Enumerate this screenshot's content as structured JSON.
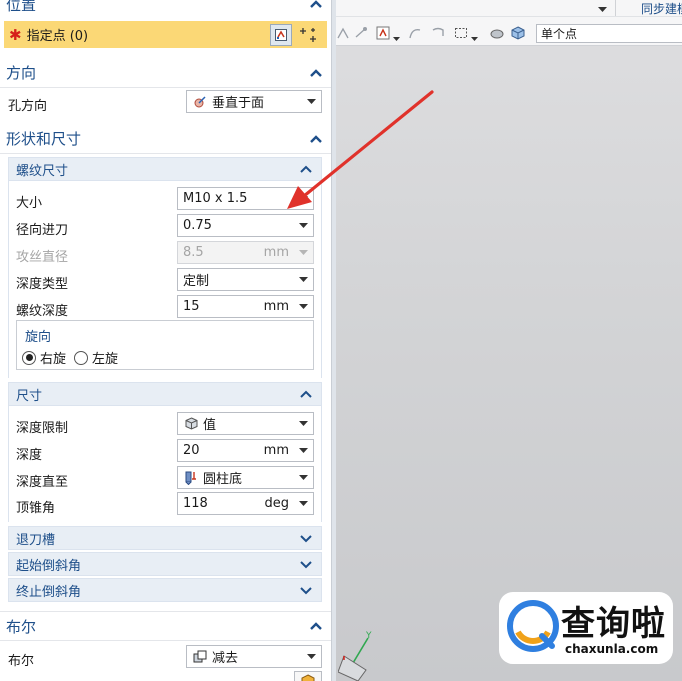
{
  "toolbar": {
    "sync_label": "同步建模",
    "filter_value": "单个点"
  },
  "sections": {
    "position": {
      "title": "位置",
      "specify_point": "指定点 (0)"
    },
    "direction": {
      "title": "方向",
      "hole_direction_label": "孔方向",
      "hole_direction_value": "垂直于面"
    },
    "shape_size": {
      "title": "形状和尺寸",
      "thread_size": {
        "title": "螺纹尺寸",
        "size_label": "大小",
        "size_value": "M10 x 1.5",
        "radial_feed_label": "径向进刀",
        "radial_feed_value": "0.75",
        "tap_diameter_label": "攻丝直径",
        "tap_diameter_value": "8.5",
        "tap_diameter_unit": "mm",
        "depth_type_label": "深度类型",
        "depth_type_value": "定制",
        "thread_depth_label": "螺纹深度",
        "thread_depth_value": "15",
        "thread_depth_unit": "mm",
        "rotation": {
          "title": "旋向",
          "right_label": "右旋",
          "left_label": "左旋"
        }
      },
      "dimensions": {
        "title": "尺寸",
        "depth_limit_label": "深度限制",
        "depth_limit_value": "值",
        "depth_label": "深度",
        "depth_value": "20",
        "depth_unit": "mm",
        "depth_to_label": "深度直至",
        "depth_to_value": "圆柱底",
        "tip_angle_label": "顶锥角",
        "tip_angle_value": "118",
        "tip_angle_unit": "deg"
      },
      "relief": {
        "title": "退刀槽"
      },
      "start_chamfer": {
        "title": "起始倒斜角"
      },
      "end_chamfer": {
        "title": "终止倒斜角"
      }
    },
    "boolean": {
      "title": "布尔",
      "boolean_label": "布尔",
      "boolean_value": "减去"
    }
  },
  "watermark": {
    "name": "查询啦",
    "url": "chaxunla.com"
  },
  "colors": {
    "accent": "#1e4f8a",
    "required_highlight": "#fbd876",
    "arrow": "#e0322b"
  }
}
